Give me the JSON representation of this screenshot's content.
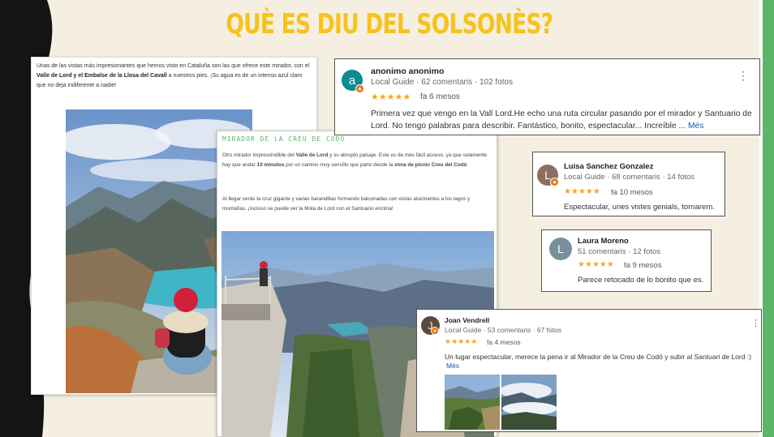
{
  "slide": {
    "title": "QUÈ ES DIU DEL SOLSONÈS?"
  },
  "blog1": {
    "text_before": "Unas de las vistas más impresionantes que hemos visto en Cataluña son las que ofrece este mirador, con el ",
    "bold": "Valle de Lord y el Embalse de la Llosa del Cavall",
    "text_after": " a nuestros pies. ¡Su agua es de un intenso azul claro que no deja indiferente a nadie!"
  },
  "blog2": {
    "heading": "MIRADOR DE LA CREU DE CODÓ",
    "p1_a": "Otro mirador imprescindible del ",
    "p1_b1": "Valle de Lord",
    "p1_c": " y su abrupto paisaje. Este es de más fácil acceso, ya que solamente hay que andar ",
    "p1_b2": "10 minutos",
    "p1_d": " por un camino muy sencillo que parte desde la ",
    "p1_b3": "zona de pícnic Creu del Codó",
    "p1_e": ".",
    "p2": "Al llegar verás la cruz gigante y varias barandillas formando balconadas con vistas alucinantes a los lagos y montañas. ¡Incluso se puede ver la Mola de Lord con el Santuario encima!"
  },
  "reviews": [
    {
      "initial": "a",
      "name": "anonimo anonimo",
      "meta": "Local Guide · 62 comentaris · 102 fotos",
      "stars": "★★★★★",
      "ago": "fa 6 mesos",
      "text": "Primera vez que vengo en la Vall Lord.He echo una ruta circular pasando por el mirador y Santuario de Lord. No tengo palabras para describir. Fantástico, bonito, espectacular... Increíble ...",
      "more": "Més",
      "avatar_color": "#0d8a94"
    },
    {
      "initial": "L",
      "name": "Luisa Sanchez Gonzalez",
      "meta": "Local Guide · 68 comentaris · 14 fotos",
      "stars": "★★★★★",
      "ago": "fa 10 mesos",
      "text": "Espectacular, unes vistes genials, tornarem.",
      "avatar_color": "#8d6e63"
    },
    {
      "initial": "L",
      "name": "Laura Moreno",
      "meta": "51 comentaris · 12 fotos",
      "stars": "★★★★★",
      "ago": "fa 9 mesos",
      "text": "Parece retocado de lo bonito que es.",
      "avatar_color": "#78909c"
    },
    {
      "initial": "J",
      "name": "Joan Vendrell",
      "meta": "Local Guide · 53 comentaris · 67 fotos",
      "stars": "★★★★★",
      "ago": "fa 4 mesos",
      "text": "Un lugar espectacular, merece la pena ir al Mirador de la Creu de Codó y subir al Santuari de Lord :)",
      "more": "Més",
      "avatar_color": "#5a4a3a"
    }
  ],
  "colors": {
    "title": "#f7c21b",
    "background": "#f4efe0",
    "accent_green": "#5bb66a",
    "star": "#f5a623",
    "link": "#1a55b5"
  },
  "icons": {
    "menu": "⋮",
    "badge": "★"
  }
}
